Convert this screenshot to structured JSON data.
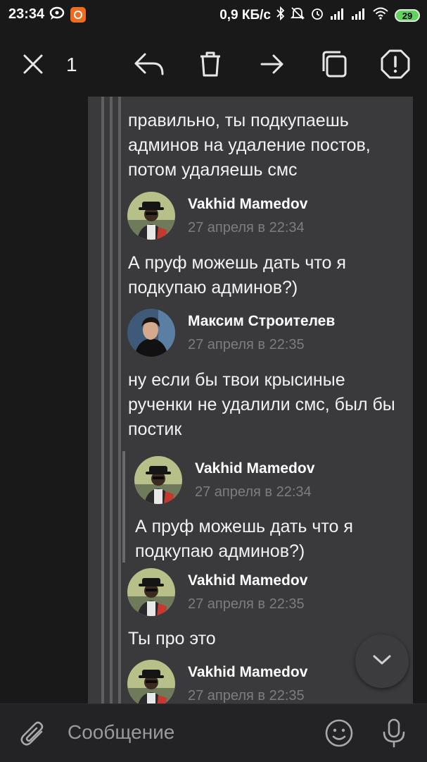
{
  "status_bar": {
    "time": "23:34",
    "network_speed": "0,9 КБ/с",
    "battery_level": "29",
    "icons": [
      "chat-notification-icon",
      "app-notification-icon",
      "bluetooth-icon",
      "mute-icon",
      "alarm-icon",
      "signal-icon",
      "signal-icon",
      "wifi-icon",
      "battery-icon"
    ]
  },
  "toolbar": {
    "selected_count": "1",
    "actions": [
      "close-icon",
      "reply-icon",
      "delete-icon",
      "forward-icon",
      "copy-icon",
      "report-icon"
    ]
  },
  "messages": [
    {
      "type": "text",
      "text": "правильно, ты подкупаешь админов на удаление постов, потом удаляешь смс"
    },
    {
      "type": "author",
      "name": "Vakhid Mamedov",
      "date": "27 апреля в 22:34"
    },
    {
      "type": "text",
      "text": "А пруф можешь дать что я подкупаю админов?)"
    },
    {
      "type": "author",
      "name": "Максим Строителев",
      "date": "27 апреля в 22:35"
    },
    {
      "type": "text",
      "text": "ну если бы твои крысиные рученки не удалили смс, был бы постик"
    },
    {
      "type": "quote_author",
      "name": "Vakhid Mamedov",
      "date": "27 апреля в 22:34"
    },
    {
      "type": "quote_text",
      "text": "А пруф можешь дать что я подкупаю админов?)"
    },
    {
      "type": "author",
      "name": "Vakhid Mamedov",
      "date": "27 апреля в 22:35"
    },
    {
      "type": "text",
      "text": "Ты про это"
    },
    {
      "type": "author",
      "name": "Vakhid Mamedov",
      "date": "27 апреля в 22:35"
    }
  ],
  "composer": {
    "placeholder": "Сообщение",
    "icons": [
      "attach-icon",
      "emoji-icon",
      "microphone-icon"
    ]
  },
  "colors": {
    "background": "#19191a",
    "panel": "#3a3a3c",
    "battery": "#5fd35b",
    "notification_badge": "#f26b1d"
  }
}
